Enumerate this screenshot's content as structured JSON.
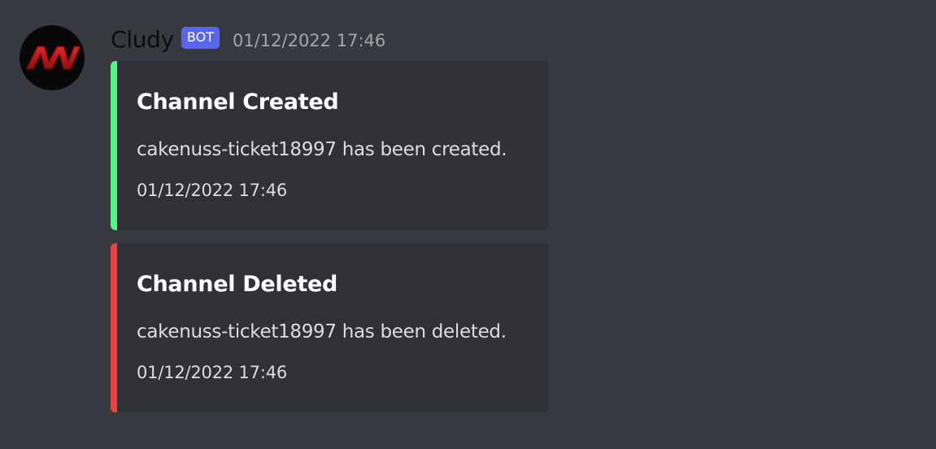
{
  "message": {
    "author": {
      "name": "Cludy",
      "badge": "BOT",
      "avatar_icon": "red-nw-logo-icon",
      "badge_color": "#5865f2"
    },
    "timestamp": "01/12/2022 17:46",
    "embeds": [
      {
        "title": "Channel Created",
        "description": "cakenuss-ticket18997 has been created.",
        "footer": "01/12/2022 17:46",
        "accent_color": "#57f287"
      },
      {
        "title": "Channel Deleted",
        "description": "cakenuss-ticket18997 has been deleted.",
        "footer": "01/12/2022 17:46",
        "accent_color": "#ed4245"
      }
    ]
  },
  "theme": {
    "background": "#36393f",
    "embed_background": "#2f3136"
  }
}
